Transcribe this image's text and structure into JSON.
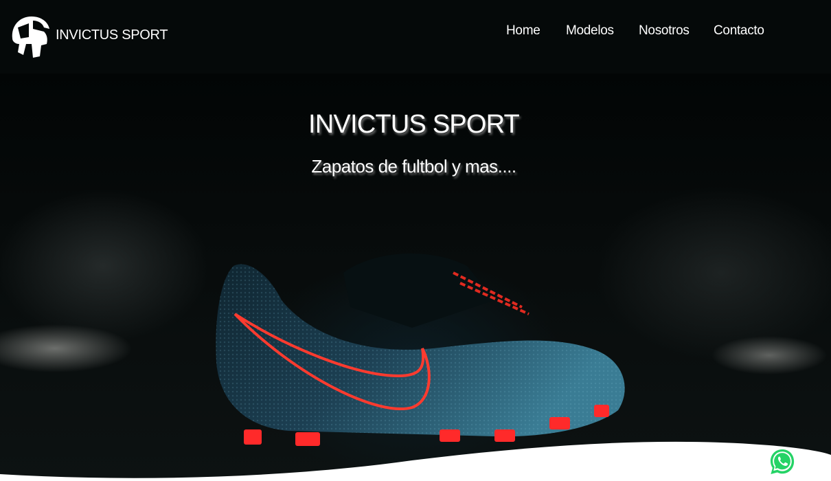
{
  "header": {
    "brand": "INVICTUS SPORT",
    "logo_icon": "spartan-helmet-icon",
    "nav": {
      "home": "Home",
      "modelos": "Modelos",
      "nosotros": "Nosotros",
      "contacto": "Contacto"
    }
  },
  "hero": {
    "title": "INVICTUS SPORT",
    "subtitle": "Zapatos de fultbol y mas...."
  },
  "floating": {
    "whatsapp_icon": "whatsapp-icon"
  },
  "colors": {
    "header_bg": "#050909",
    "text": "#ffffff",
    "accent_red": "#ff3b2f",
    "whatsapp_green": "#25d366"
  }
}
